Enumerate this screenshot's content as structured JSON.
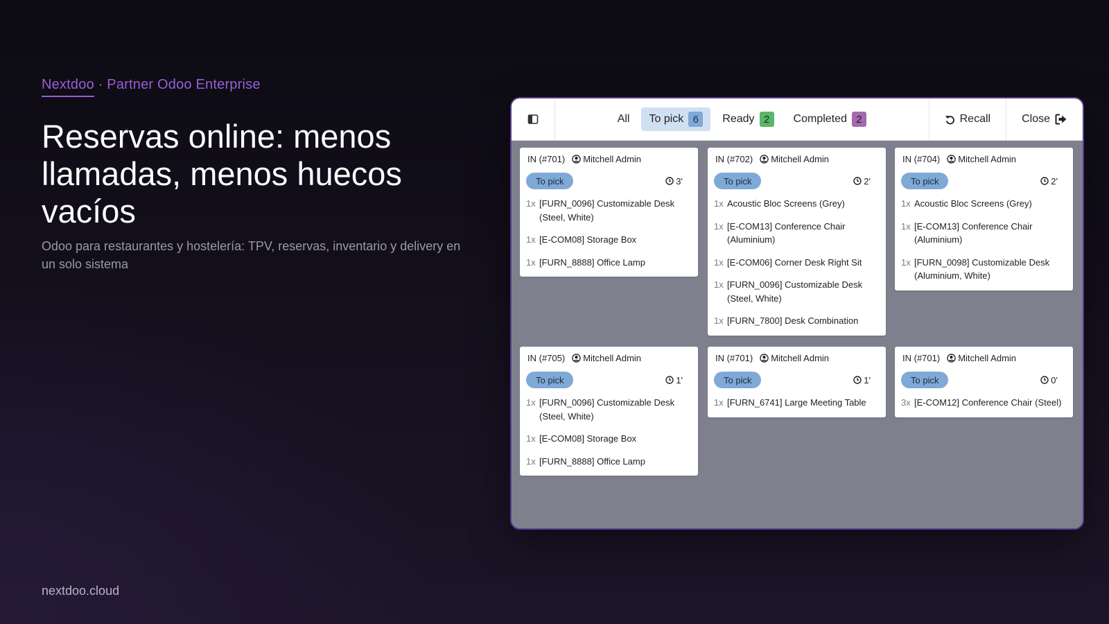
{
  "hero": {
    "eyebrow_brand": "Nextdoo",
    "eyebrow_rest": " · Partner Odoo Enterprise",
    "title": "Reservas online: menos llamadas, menos huecos vacíos",
    "subtitle": "Odoo para restaurantes y hostelería: TPV, reservas, inventario y delivery en un solo sistema",
    "footer": "nextdoo.cloud"
  },
  "colors": {
    "accent": "#9b5ed6",
    "to_pick_badge": "#7fa9d6",
    "ready_badge": "#5bb56a",
    "completed_badge": "#a36aae"
  },
  "toolbar": {
    "toggle_icon": "sidebar-toggle-icon",
    "tabs": [
      {
        "label": "All"
      },
      {
        "label": "To pick",
        "count": "6"
      },
      {
        "label": "Ready",
        "count": "2"
      },
      {
        "label": "Completed",
        "count": "2"
      }
    ],
    "recall_label": "Recall",
    "close_label": "Close"
  },
  "cards": [
    {
      "ref": "IN (#701)",
      "user": "Mitchell Admin",
      "status": "To pick",
      "time": "3'",
      "lines": [
        {
          "qty": "1x",
          "name": "[FURN_0096] Customizable Desk (Steel, White)"
        },
        {
          "qty": "1x",
          "name": "[E-COM08] Storage Box"
        },
        {
          "qty": "1x",
          "name": "[FURN_8888] Office Lamp"
        }
      ]
    },
    {
      "ref": "IN (#702)",
      "user": "Mitchell Admin",
      "status": "To pick",
      "time": "2'",
      "lines": [
        {
          "qty": "1x",
          "name": "Acoustic Bloc Screens (Grey)"
        },
        {
          "qty": "1x",
          "name": "[E-COM13] Conference Chair (Aluminium)"
        },
        {
          "qty": "1x",
          "name": "[E-COM06] Corner Desk Right Sit"
        },
        {
          "qty": "1x",
          "name": "[FURN_0096] Customizable Desk (Steel, White)"
        },
        {
          "qty": "1x",
          "name": "[FURN_7800] Desk Combination"
        }
      ]
    },
    {
      "ref": "IN (#704)",
      "user": "Mitchell Admin",
      "status": "To pick",
      "time": "2'",
      "lines": [
        {
          "qty": "1x",
          "name": "Acoustic Bloc Screens (Grey)"
        },
        {
          "qty": "1x",
          "name": "[E-COM13] Conference Chair (Aluminium)"
        },
        {
          "qty": "1x",
          "name": "[FURN_0098] Customizable Desk (Aluminium, White)"
        }
      ]
    },
    {
      "ref": "IN (#705)",
      "user": "Mitchell Admin",
      "status": "To pick",
      "time": "1'",
      "lines": [
        {
          "qty": "1x",
          "name": "[FURN_0096] Customizable Desk (Steel, White)"
        },
        {
          "qty": "1x",
          "name": "[E-COM08] Storage Box"
        },
        {
          "qty": "1x",
          "name": "[FURN_8888] Office Lamp"
        }
      ]
    },
    {
      "ref": "IN (#701)",
      "user": "Mitchell Admin",
      "status": "To pick",
      "time": "1'",
      "lines": [
        {
          "qty": "1x",
          "name": "[FURN_6741] Large Meeting Table"
        }
      ]
    },
    {
      "ref": "IN (#701)",
      "user": "Mitchell Admin",
      "status": "To pick",
      "time": "0'",
      "lines": [
        {
          "qty": "3x",
          "name": "[E-COM12] Conference Chair (Steel)"
        }
      ]
    }
  ]
}
